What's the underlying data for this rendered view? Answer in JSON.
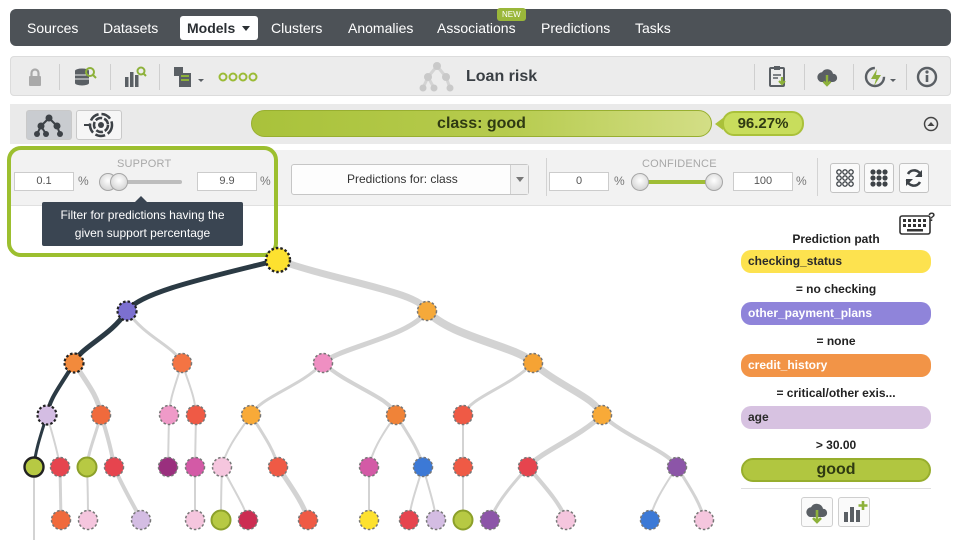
{
  "nav": {
    "items": [
      "Sources",
      "Datasets",
      "Models",
      "Clusters",
      "Anomalies",
      "Associations",
      "Predictions",
      "Tasks"
    ],
    "active": "Models",
    "new_badge": "NEW"
  },
  "toolbar": {
    "title": "Loan risk"
  },
  "classbar": {
    "class_label": "class: good",
    "confidence": "96.27%"
  },
  "filters": {
    "support_label": "SUPPORT",
    "support_min": "0.1",
    "support_max": "9.9",
    "percent_sign": "%",
    "predictions_for": "Predictions for: class",
    "confidence_label": "CONFIDENCE",
    "confidence_min": "0",
    "confidence_max": "100",
    "tooltip_line1": "Filter for predictions having the",
    "tooltip_line2": "given support percentage"
  },
  "prediction_path": {
    "title": "Prediction path",
    "steps": [
      {
        "field": "checking_status",
        "color": "#fde24f",
        "condition": "= no checking"
      },
      {
        "field": "other_payment_plans",
        "color": "#8f84da",
        "condition": "= none"
      },
      {
        "field": "credit_history",
        "color": "#f29447",
        "condition": "= critical/other exis..."
      },
      {
        "field": "age",
        "color": "#d7c2e1",
        "condition": "> 30.00"
      }
    ],
    "result": "good",
    "help_mark": "?"
  },
  "colors": {
    "accent_green": "#a6c03a",
    "nav_bg": "#4d5257",
    "path_dark": "#2b3a44"
  },
  "icons": {
    "lock": "lock-icon",
    "dataset": "dataset-search-icon",
    "chart": "chart-search-icon",
    "tree_model": "tree-model-icon",
    "sunburst": "sunburst-icon",
    "download_pdf": "document-download-icon",
    "cloud_download": "cloud-download-icon",
    "actions": "lightning-actions-icon",
    "info": "info-icon"
  }
}
